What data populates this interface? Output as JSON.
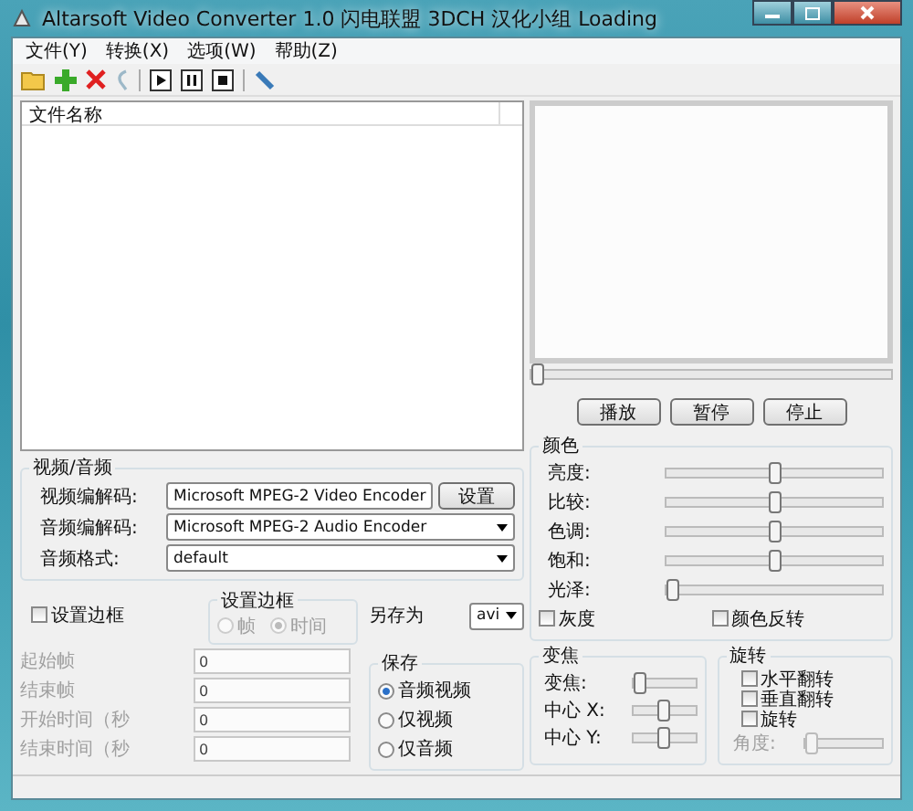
{
  "window": {
    "title": "Altarsoft Video Converter 1.0 闪电联盟 3DCH 汉化小组 Loading"
  },
  "menus": [
    {
      "label": "文件(Y)"
    },
    {
      "label": "转换(X)"
    },
    {
      "label": "选项(W)"
    },
    {
      "label": "帮助(Z)"
    }
  ],
  "file_list": {
    "header": "文件名称"
  },
  "seek": {
    "level": 0
  },
  "player_buttons": [
    "播放",
    "暂停",
    "停止"
  ],
  "video_audio": {
    "title": "视频/音频",
    "rows": [
      {
        "label": "视频编解码:",
        "value": "Microsoft MPEG-2 Video Encoder",
        "button": "设置"
      },
      {
        "label": "音频编解码:",
        "value": "Microsoft MPEG-2 Audio Encoder"
      },
      {
        "label": "音频格式:",
        "value": "default"
      }
    ]
  },
  "border": {
    "checkbox": {
      "label": "设置边框",
      "checked": false
    },
    "group": {
      "title": "设置边框",
      "options": [
        {
          "label": "帧",
          "selected": false,
          "disabled": true
        },
        {
          "label": "时间",
          "selected": true,
          "disabled": true
        }
      ]
    }
  },
  "save_as": {
    "label": "另存为",
    "value": "avi"
  },
  "fields": [
    {
      "label": "起始帧",
      "value": "0",
      "disabled": true
    },
    {
      "label": "结束帧",
      "value": "0",
      "disabled": true
    },
    {
      "label": "开始时间（秒",
      "value": "0",
      "disabled": true
    },
    {
      "label": "结束时间（秒",
      "value": "0",
      "disabled": true
    }
  ],
  "save": {
    "title": "保存",
    "options": [
      {
        "label": "音频视频",
        "selected": true
      },
      {
        "label": "仅视频",
        "selected": false
      },
      {
        "label": "仅音频",
        "selected": false
      }
    ]
  },
  "color": {
    "title": "颜色",
    "sliders": [
      {
        "label": "亮度:",
        "level": 0.5
      },
      {
        "label": "比较:",
        "level": 0.5
      },
      {
        "label": "色调:",
        "level": 0.5
      },
      {
        "label": "饱和:",
        "level": 0.5
      },
      {
        "label": "光泽:",
        "level": 0
      }
    ],
    "checkboxes": [
      {
        "label": "灰度",
        "checked": false
      },
      {
        "label": "颜色反转",
        "checked": false
      }
    ]
  },
  "zoom": {
    "title": "变焦",
    "sliders": [
      {
        "label": "变焦:",
        "level": 0
      },
      {
        "label": "中心 X:",
        "level": 0.5
      },
      {
        "label": "中心 Y:",
        "level": 0.5
      }
    ]
  },
  "rotate": {
    "title": "旋转",
    "checkboxes": [
      {
        "label": "水平翻转",
        "checked": false
      },
      {
        "label": "垂直翻转",
        "checked": false
      },
      {
        "label": "旋转",
        "checked": false
      }
    ],
    "angle": {
      "label": "角度:",
      "level": 0,
      "disabled": true
    }
  }
}
